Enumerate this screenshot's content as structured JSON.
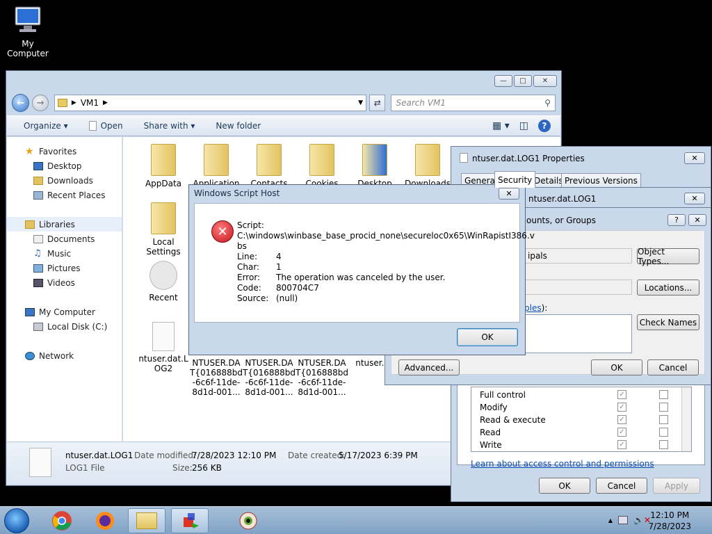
{
  "desktop": {
    "my_computer_label": "My Computer"
  },
  "explorer": {
    "breadcrumb": "VM1",
    "search_placeholder": "Search VM1",
    "toolbar": {
      "organize": "Organize",
      "open": "Open",
      "share_with": "Share with",
      "new_folder": "New folder"
    },
    "sidebar": {
      "favorites": "Favorites",
      "desktop": "Desktop",
      "downloads": "Downloads",
      "recent_places": "Recent Places",
      "libraries": "Libraries",
      "documents": "Documents",
      "music": "Music",
      "pictures": "Pictures",
      "videos": "Videos",
      "my_computer": "My Computer",
      "local_disk": "Local Disk (C:)",
      "network": "Network"
    },
    "items": {
      "appdata": "AppData",
      "application": "Application",
      "contacts": "Contacts",
      "cookies": "Cookies",
      "desktop": "Desktop",
      "downloads": "Downloads",
      "local_settings_1": "Local",
      "local_settings_2": "Settings",
      "recent": "Recent",
      "ntuser_log2_1": "ntuser.dat.L",
      "ntuser_log2_2": "OG2",
      "ntuser_blf_a1": "NTUSER.DA",
      "ntuser_blf_a2": "T{016888bd",
      "ntuser_blf_a3": "-6c6f-11de-",
      "ntuser_blf_a4": "8d1d-001...",
      "ntuser_blf_b1": "NTUSER.DA",
      "ntuser_blf_b2": "T{016888bd",
      "ntuser_blf_b3": "-6c6f-11de-",
      "ntuser_blf_b4": "8d1d-001...",
      "ntuser_blf_c1": "NTUSER.DA",
      "ntuser_blf_c2": "T{016888bd",
      "ntuser_blf_c3": "-6c6f-11de-",
      "ntuser_blf_c4": "8d1d-001...",
      "ntuser_ini": "ntuser.ini"
    },
    "details": {
      "name": "ntuser.dat.LOG1",
      "type": "LOG1 File",
      "date_modified_label": "Date modified:",
      "date_modified": "7/28/2023 12:10 PM",
      "size_label": "Size:",
      "size": "256 KB",
      "date_created_label": "Date created:",
      "date_created": "5/17/2023 6:39 PM"
    }
  },
  "properties": {
    "title": "ntuser.dat.LOG1 Properties",
    "tabs": [
      "General",
      "Security",
      "Details",
      "Previous Versions"
    ],
    "perm_rows": [
      "Full control",
      "Modify",
      "Read & execute",
      "Read",
      "Write"
    ],
    "learn_link": "Learn about access control and permissions",
    "ok": "OK",
    "cancel": "Cancel",
    "apply": "Apply"
  },
  "permissions_dialog": {
    "title": "ntuser.dat.LOG1"
  },
  "select_users": {
    "title_fragment": "ounts, or Groups",
    "object_type_fragment": "ipals",
    "object_types_btn": "Object Types...",
    "locations_btn": "Locations...",
    "names_fragment": "ples",
    "names_suffix": "):",
    "check_names_btn": "Check Names",
    "advanced_btn": "Advanced...",
    "ok": "OK",
    "cancel": "Cancel"
  },
  "wsh": {
    "title": "Windows Script Host",
    "script_label": "Script:",
    "script_path_1": "C:\\windows\\winbase_base_procid_none\\secureloc0x65\\WinRapistI386.v",
    "script_path_2": "bs",
    "line_label": "Line:",
    "line": "4",
    "char_label": "Char:",
    "char": "1",
    "error_label": "Error:",
    "error": "The operation was canceled by the user.",
    "code_label": "Code:",
    "code": "800704C7",
    "source_label": "Source:",
    "source": "(null)",
    "ok": "OK"
  },
  "taskbar": {
    "time": "12:10 PM",
    "date": "7/28/2023"
  }
}
